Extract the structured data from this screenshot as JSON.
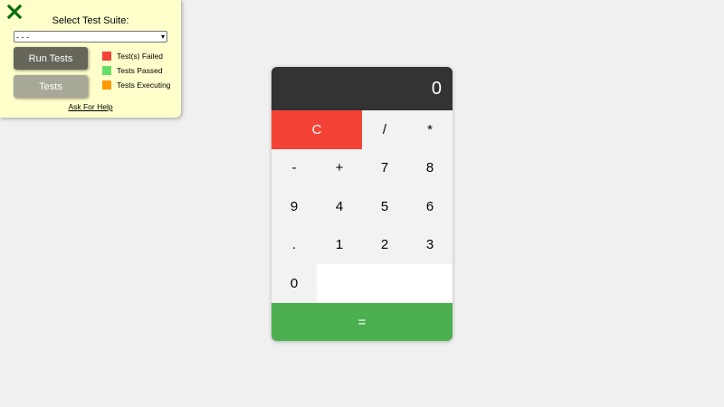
{
  "test_panel": {
    "close_icon": "close-x-icon",
    "close_color": "#0a6e0a",
    "title": "Select Test Suite:",
    "suite_select": {
      "value": "- - -"
    },
    "run_button_label": "Run Tests",
    "tests_button_label": "Tests",
    "legend": [
      {
        "label": "Test(s) Failed",
        "color": "#f44336"
      },
      {
        "label": "Tests Passed",
        "color": "#66dd66"
      },
      {
        "label": "Tests Executing",
        "color": "#ff9900"
      }
    ],
    "help_link": "Ask For Help"
  },
  "calculator": {
    "display": "0",
    "keys": {
      "clear": "C",
      "divide": "/",
      "multiply": "*",
      "minus": "-",
      "plus": "+",
      "seven": "7",
      "eight": "8",
      "nine": "9",
      "four": "4",
      "five": "5",
      "six": "6",
      "decimal": ".",
      "one": "1",
      "two": "2",
      "three": "3",
      "zero": "0",
      "equals": "="
    },
    "colors": {
      "display_bg": "#333333",
      "clear_bg": "#f44336",
      "equals_bg": "#4caf50"
    }
  }
}
